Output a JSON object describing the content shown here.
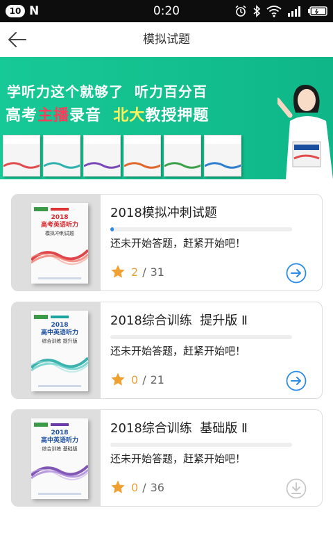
{
  "status_bar": {
    "notification_count": "10",
    "app_letter": "N",
    "time": "0:20",
    "icons": [
      "alarm-icon",
      "bluetooth-icon",
      "wifi-icon",
      "signal-icon",
      "battery-icon"
    ]
  },
  "header": {
    "title": "模拟试题",
    "back_icon": "arrow-left-icon"
  },
  "banner": {
    "line1": "学听力这个就够了  听力百分百",
    "line2_prefix": "高考",
    "line2_red": "主播",
    "line2_mid": "录音  ",
    "line2_yellow": "北大",
    "line2_suffix": "教授押题",
    "accent_red": "#ff3b5c",
    "accent_yellow": "#fff25a",
    "background": "#15c392"
  },
  "cards": [
    {
      "title": "2018模拟冲刺试题",
      "message": "还未开始答题，赶紧开始吧！",
      "done": "2",
      "total": "31",
      "progress": 0.02,
      "action": "arrow-right-icon",
      "action_color": "#2b8be8",
      "book": {
        "year": "2018",
        "name": "高考英语听力",
        "subtitle": "模拟冲刺试题",
        "theme_color": "#d8262b"
      }
    },
    {
      "title": "2018综合训练  提升版 Ⅱ",
      "message": "还未开始答题，赶紧开始吧！",
      "done": "0",
      "total": "21",
      "progress": 0,
      "action": "arrow-right-icon",
      "action_color": "#2b8be8",
      "book": {
        "year": "2018",
        "name": "高中英语听力",
        "subtitle": "综合训练  提升版",
        "theme_color": "#1aa5a0"
      }
    },
    {
      "title": "2018综合训练  基础版 Ⅱ",
      "message": "还未开始答题，赶紧开始吧！",
      "done": "0",
      "total": "36",
      "progress": 0,
      "action": "download-icon",
      "action_color": "#c8c8c8",
      "book": {
        "year": "2018",
        "name": "高中英语听力",
        "subtitle": "综合训练  基础版",
        "theme_color": "#6b3aa8"
      }
    }
  ]
}
